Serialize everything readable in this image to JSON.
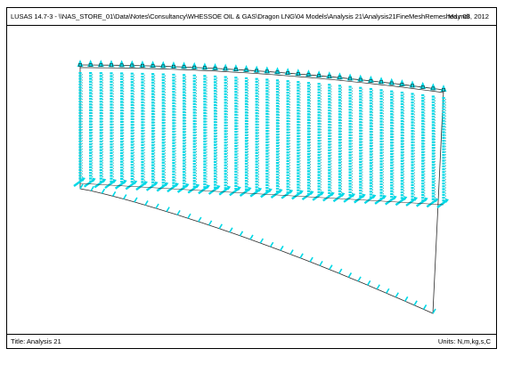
{
  "header": {
    "path": "LUSAS 14.7-3 - \\\\NAS_STORE_01\\Data\\Notes\\Consultancy\\WHESSOE OIL & GAS\\Dragon LNG\\04 Models\\Analysis 21\\Analysis21FineMeshRemeshed.mdl",
    "date": "May 03, 2012"
  },
  "footer": {
    "title": "Title: Analysis 21",
    "units": "Units: N,m,kg,s,C"
  },
  "model": {
    "load_color": "#00d8e6",
    "load_dark": "#008a96",
    "mesh_color": "#2a2a2a",
    "panel_fill": "#ffffff",
    "column_count": 36
  }
}
